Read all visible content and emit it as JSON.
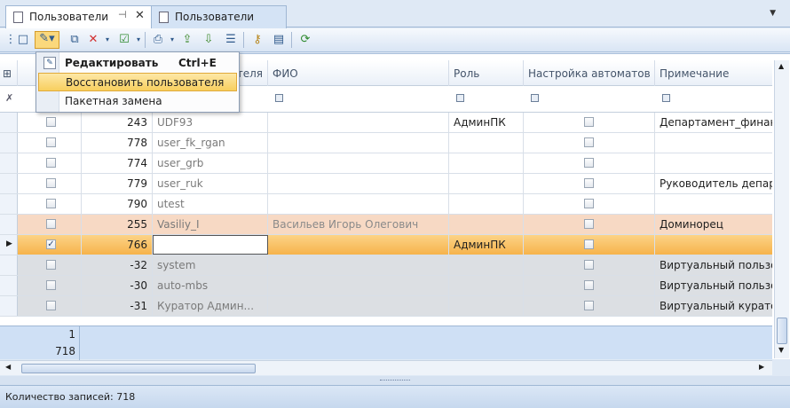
{
  "tabs": [
    {
      "label": "Пользователи",
      "active": true
    },
    {
      "label": "Пользователи",
      "active": false
    }
  ],
  "toolbar_icons": [
    "new-icon",
    "edit-icon",
    "dropdown-icon",
    "copy-icon",
    "delete-icon",
    "dropdown-icon",
    "check-icon",
    "dropdown-icon",
    "print-icon",
    "dropdown-icon",
    "export-icon",
    "import-icon",
    "list-icon",
    "key-icon",
    "book-icon",
    "refresh-icon"
  ],
  "columns": {
    "col_name_tail": "ателя",
    "fio": "ФИО",
    "role": "Роль",
    "automata": "Настройка автоматов",
    "note": "Примечание"
  },
  "rows": [
    {
      "id": "243",
      "name": "UDF93",
      "fio": "",
      "role": "АдминПК",
      "auto": false,
      "note": "Департамент_финансов",
      "cb": false,
      "style": "white"
    },
    {
      "id": "778",
      "name": "user_fk_rgan",
      "fio": "",
      "role": "",
      "auto": false,
      "note": "",
      "cb": false,
      "style": "white"
    },
    {
      "id": "774",
      "name": "user_grb",
      "fio": "",
      "role": "",
      "auto": false,
      "note": "",
      "cb": false,
      "style": "white"
    },
    {
      "id": "779",
      "name": "user_ruk",
      "fio": "",
      "role": "",
      "auto": false,
      "note": "Руководитель департамента",
      "cb": false,
      "style": "white"
    },
    {
      "id": "790",
      "name": "utest",
      "fio": "",
      "role": "",
      "auto": false,
      "note": "",
      "cb": false,
      "style": "white"
    },
    {
      "id": "255",
      "name": "Vasiliy_I",
      "fio": "Васильев Игорь Олегович",
      "role": "",
      "auto": false,
      "note": "Доминорец",
      "cb": false,
      "style": "peach"
    },
    {
      "id": "766",
      "name": "",
      "fio": "",
      "role": "АдминПК",
      "auto": false,
      "note": "",
      "cb": true,
      "style": "sel"
    },
    {
      "id": "-32",
      "name": "system",
      "fio": "",
      "role": "",
      "auto": false,
      "note": "Виртуальный пользователь",
      "cb": false,
      "style": "gray"
    },
    {
      "id": "-30",
      "name": "auto-mbs",
      "fio": "",
      "role": "",
      "auto": false,
      "note": "Виртуальный пользователь",
      "cb": false,
      "style": "gray"
    },
    {
      "id": "-31",
      "name": "Куратор Админ...",
      "fio": "",
      "role": "",
      "auto": false,
      "note": "Виртуальный куратор",
      "cb": false,
      "style": "gray"
    }
  ],
  "footer": {
    "count_selected": "1",
    "total": "718"
  },
  "menu": {
    "edit_label": "Редактировать",
    "edit_shortcut": "Ctrl+E",
    "restore_label": "Восстановить пользователя",
    "batch_label": "Пакетная замена"
  },
  "status": {
    "text": "Количество записей: 718"
  },
  "colors": {
    "accent": "#f8cf5e",
    "header_bg": "#dfe9f5",
    "selected_row": "#f6b34b",
    "peach_row": "#f7d9c4"
  }
}
